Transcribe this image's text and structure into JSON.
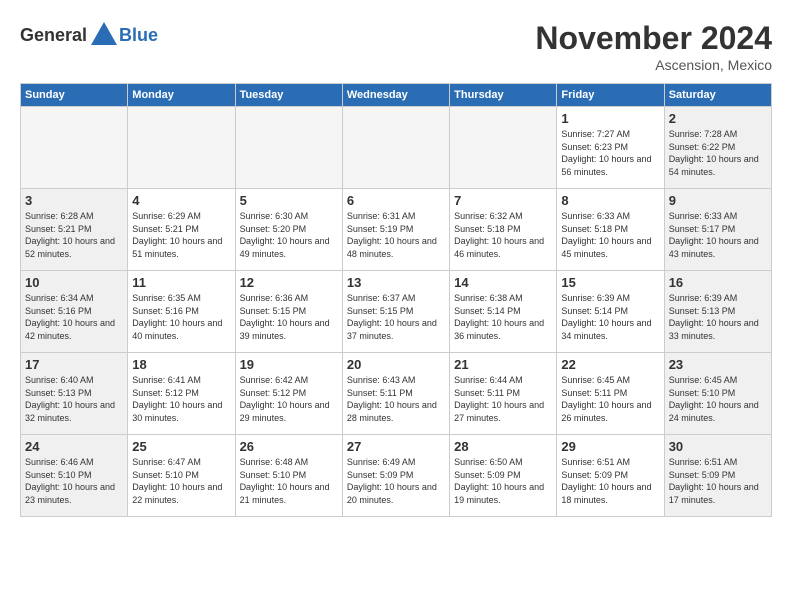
{
  "header": {
    "logo_general": "General",
    "logo_blue": "Blue",
    "month": "November 2024",
    "location": "Ascension, Mexico"
  },
  "days_of_week": [
    "Sunday",
    "Monday",
    "Tuesday",
    "Wednesday",
    "Thursday",
    "Friday",
    "Saturday"
  ],
  "weeks": [
    [
      {
        "day": "",
        "empty": true
      },
      {
        "day": "",
        "empty": true
      },
      {
        "day": "",
        "empty": true
      },
      {
        "day": "",
        "empty": true
      },
      {
        "day": "",
        "empty": true
      },
      {
        "day": "1",
        "sunrise": "Sunrise: 7:27 AM",
        "sunset": "Sunset: 6:23 PM",
        "daylight": "Daylight: 10 hours and 56 minutes."
      },
      {
        "day": "2",
        "sunrise": "Sunrise: 7:28 AM",
        "sunset": "Sunset: 6:22 PM",
        "daylight": "Daylight: 10 hours and 54 minutes."
      }
    ],
    [
      {
        "day": "3",
        "sunrise": "Sunrise: 6:28 AM",
        "sunset": "Sunset: 5:21 PM",
        "daylight": "Daylight: 10 hours and 52 minutes."
      },
      {
        "day": "4",
        "sunrise": "Sunrise: 6:29 AM",
        "sunset": "Sunset: 5:21 PM",
        "daylight": "Daylight: 10 hours and 51 minutes."
      },
      {
        "day": "5",
        "sunrise": "Sunrise: 6:30 AM",
        "sunset": "Sunset: 5:20 PM",
        "daylight": "Daylight: 10 hours and 49 minutes."
      },
      {
        "day": "6",
        "sunrise": "Sunrise: 6:31 AM",
        "sunset": "Sunset: 5:19 PM",
        "daylight": "Daylight: 10 hours and 48 minutes."
      },
      {
        "day": "7",
        "sunrise": "Sunrise: 6:32 AM",
        "sunset": "Sunset: 5:18 PM",
        "daylight": "Daylight: 10 hours and 46 minutes."
      },
      {
        "day": "8",
        "sunrise": "Sunrise: 6:33 AM",
        "sunset": "Sunset: 5:18 PM",
        "daylight": "Daylight: 10 hours and 45 minutes."
      },
      {
        "day": "9",
        "sunrise": "Sunrise: 6:33 AM",
        "sunset": "Sunset: 5:17 PM",
        "daylight": "Daylight: 10 hours and 43 minutes."
      }
    ],
    [
      {
        "day": "10",
        "sunrise": "Sunrise: 6:34 AM",
        "sunset": "Sunset: 5:16 PM",
        "daylight": "Daylight: 10 hours and 42 minutes."
      },
      {
        "day": "11",
        "sunrise": "Sunrise: 6:35 AM",
        "sunset": "Sunset: 5:16 PM",
        "daylight": "Daylight: 10 hours and 40 minutes."
      },
      {
        "day": "12",
        "sunrise": "Sunrise: 6:36 AM",
        "sunset": "Sunset: 5:15 PM",
        "daylight": "Daylight: 10 hours and 39 minutes."
      },
      {
        "day": "13",
        "sunrise": "Sunrise: 6:37 AM",
        "sunset": "Sunset: 5:15 PM",
        "daylight": "Daylight: 10 hours and 37 minutes."
      },
      {
        "day": "14",
        "sunrise": "Sunrise: 6:38 AM",
        "sunset": "Sunset: 5:14 PM",
        "daylight": "Daylight: 10 hours and 36 minutes."
      },
      {
        "day": "15",
        "sunrise": "Sunrise: 6:39 AM",
        "sunset": "Sunset: 5:14 PM",
        "daylight": "Daylight: 10 hours and 34 minutes."
      },
      {
        "day": "16",
        "sunrise": "Sunrise: 6:39 AM",
        "sunset": "Sunset: 5:13 PM",
        "daylight": "Daylight: 10 hours and 33 minutes."
      }
    ],
    [
      {
        "day": "17",
        "sunrise": "Sunrise: 6:40 AM",
        "sunset": "Sunset: 5:13 PM",
        "daylight": "Daylight: 10 hours and 32 minutes."
      },
      {
        "day": "18",
        "sunrise": "Sunrise: 6:41 AM",
        "sunset": "Sunset: 5:12 PM",
        "daylight": "Daylight: 10 hours and 30 minutes."
      },
      {
        "day": "19",
        "sunrise": "Sunrise: 6:42 AM",
        "sunset": "Sunset: 5:12 PM",
        "daylight": "Daylight: 10 hours and 29 minutes."
      },
      {
        "day": "20",
        "sunrise": "Sunrise: 6:43 AM",
        "sunset": "Sunset: 5:11 PM",
        "daylight": "Daylight: 10 hours and 28 minutes."
      },
      {
        "day": "21",
        "sunrise": "Sunrise: 6:44 AM",
        "sunset": "Sunset: 5:11 PM",
        "daylight": "Daylight: 10 hours and 27 minutes."
      },
      {
        "day": "22",
        "sunrise": "Sunrise: 6:45 AM",
        "sunset": "Sunset: 5:11 PM",
        "daylight": "Daylight: 10 hours and 26 minutes."
      },
      {
        "day": "23",
        "sunrise": "Sunrise: 6:45 AM",
        "sunset": "Sunset: 5:10 PM",
        "daylight": "Daylight: 10 hours and 24 minutes."
      }
    ],
    [
      {
        "day": "24",
        "sunrise": "Sunrise: 6:46 AM",
        "sunset": "Sunset: 5:10 PM",
        "daylight": "Daylight: 10 hours and 23 minutes."
      },
      {
        "day": "25",
        "sunrise": "Sunrise: 6:47 AM",
        "sunset": "Sunset: 5:10 PM",
        "daylight": "Daylight: 10 hours and 22 minutes."
      },
      {
        "day": "26",
        "sunrise": "Sunrise: 6:48 AM",
        "sunset": "Sunset: 5:10 PM",
        "daylight": "Daylight: 10 hours and 21 minutes."
      },
      {
        "day": "27",
        "sunrise": "Sunrise: 6:49 AM",
        "sunset": "Sunset: 5:09 PM",
        "daylight": "Daylight: 10 hours and 20 minutes."
      },
      {
        "day": "28",
        "sunrise": "Sunrise: 6:50 AM",
        "sunset": "Sunset: 5:09 PM",
        "daylight": "Daylight: 10 hours and 19 minutes."
      },
      {
        "day": "29",
        "sunrise": "Sunrise: 6:51 AM",
        "sunset": "Sunset: 5:09 PM",
        "daylight": "Daylight: 10 hours and 18 minutes."
      },
      {
        "day": "30",
        "sunrise": "Sunrise: 6:51 AM",
        "sunset": "Sunset: 5:09 PM",
        "daylight": "Daylight: 10 hours and 17 minutes."
      }
    ]
  ]
}
